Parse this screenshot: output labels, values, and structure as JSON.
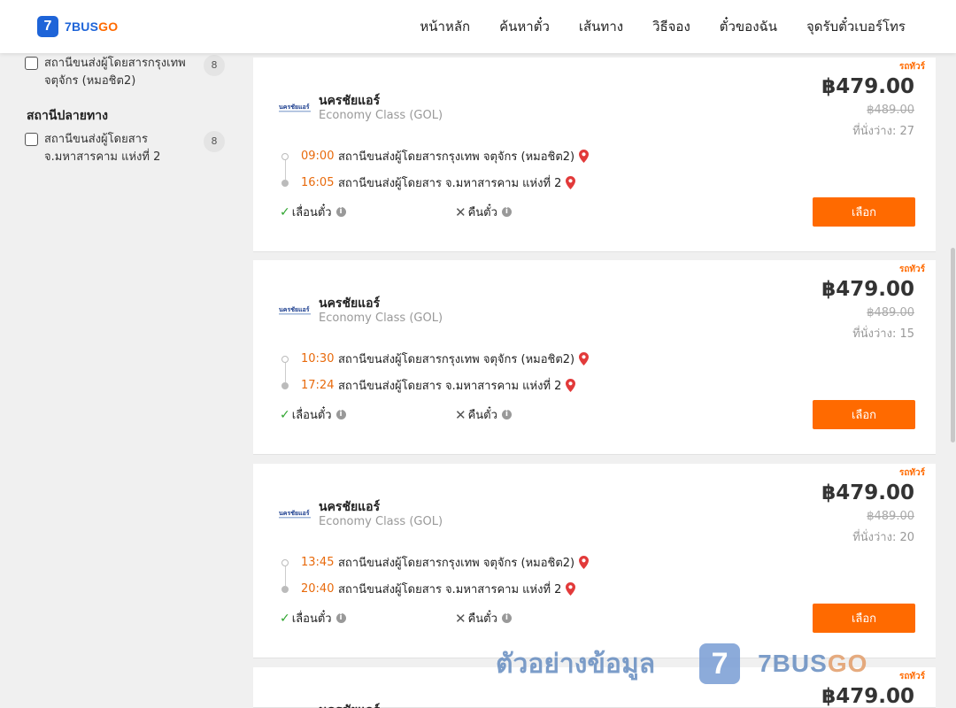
{
  "header": {
    "logo": {
      "badge": "7",
      "text_blue": "7BUS",
      "text_orange": "GO"
    },
    "nav": [
      "หน้าหลัก",
      "ค้นหาตั๋ว",
      "เส้นทาง",
      "วิธีจอง",
      "ตั๋วของฉัน",
      "จุดรับตั๋วเบอร์โทร"
    ]
  },
  "sidebar": {
    "origin_filter": {
      "label": "สถานีขนส่งผู้โดยสารกรุงเทพ จตุจักร (หมอชิต2)",
      "count": "8"
    },
    "destination_title": "สถานีปลายทาง",
    "destination_filter": {
      "label": "สถานีขนส่งผู้โดยสาร จ.มหาสารคาม แห่งที่ 2",
      "count": "8"
    }
  },
  "cards": [
    {
      "tag": "รถทัวร์",
      "operator": "นครชัยแอร์",
      "class": "Economy Class (GOL)",
      "price": "฿479.00",
      "old_price": "฿489.00",
      "seats": "ที่นั่งว่าง: 27",
      "depart_time": "09:00",
      "depart_station": "สถานีขนส่งผู้โดยสารกรุงเทพ จตุจักร (หมอชิต2)",
      "arrive_time": "16:05",
      "arrive_station": "สถานีขนส่งผู้โดยสาร จ.มหาสารคาม แห่งที่ 2",
      "reschedule": "เลื่อนตั๋ว",
      "refund": "คืนตั๋ว",
      "button": "เลือก"
    },
    {
      "tag": "รถทัวร์",
      "operator": "นครชัยแอร์",
      "class": "Economy Class (GOL)",
      "price": "฿479.00",
      "old_price": "฿489.00",
      "seats": "ที่นั่งว่าง: 15",
      "depart_time": "10:30",
      "depart_station": "สถานีขนส่งผู้โดยสารกรุงเทพ จตุจักร (หมอชิต2)",
      "arrive_time": "17:24",
      "arrive_station": "สถานีขนส่งผู้โดยสาร จ.มหาสารคาม แห่งที่ 2",
      "reschedule": "เลื่อนตั๋ว",
      "refund": "คืนตั๋ว",
      "button": "เลือก"
    },
    {
      "tag": "รถทัวร์",
      "operator": "นครชัยแอร์",
      "class": "Economy Class (GOL)",
      "price": "฿479.00",
      "old_price": "฿489.00",
      "seats": "ที่นั่งว่าง: 20",
      "depart_time": "13:45",
      "depart_station": "สถานีขนส่งผู้โดยสารกรุงเทพ จตุจักร (หมอชิต2)",
      "arrive_time": "20:40",
      "arrive_station": "สถานีขนส่งผู้โดยสาร จ.มหาสารคาม แห่งที่ 2",
      "reschedule": "เลื่อนตั๋ว",
      "refund": "คืนตั๋ว",
      "button": "เลือก"
    },
    {
      "tag": "รถทัวร์",
      "operator": "นครชัยแอร์",
      "price": "฿479.00"
    }
  ],
  "watermark": {
    "text": "ตัวอย่างข้อมูล",
    "badge": "7",
    "brand_main": "7BUS",
    "brand_go": "GO"
  },
  "colors": {
    "accent": "#ff6a00",
    "brand_blue": "#1e64d8",
    "time": "#e86a0c",
    "pin": "#e23a3a"
  }
}
